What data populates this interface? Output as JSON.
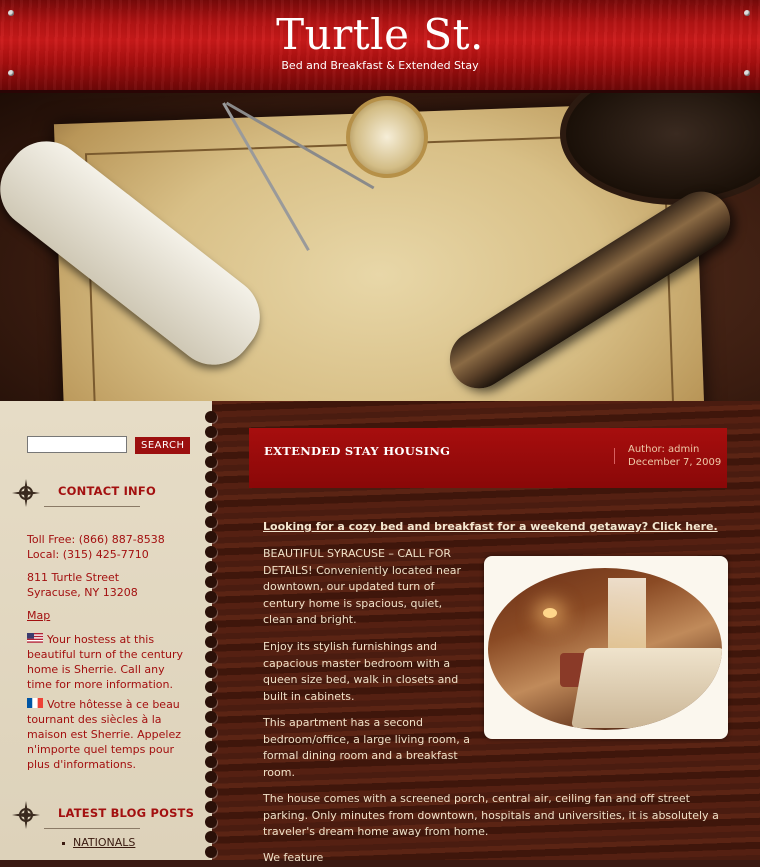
{
  "header": {
    "title": "Turtle St.",
    "tagline": "Bed and Breakfast & Extended Stay"
  },
  "sidebar": {
    "search": {
      "placeholder": "",
      "value": "",
      "button_label": "SEARCH"
    },
    "contact": {
      "heading": "CONTACT INFO",
      "toll_free": "Toll Free: (866) 887-8538",
      "local": "Local: (315) 425-7710",
      "address_line1": "811 Turtle Street",
      "address_line2": "Syracuse, NY 13208",
      "map_link": "Map",
      "english_note": "Your hostess at this beautiful turn of the century home is Sherrie. Call any time for more information.",
      "french_note": "Votre hôtesse à ce beau tournant des siècles à la maison est Sherrie. Appelez n'importe quel temps pour plus d'informations."
    },
    "blog": {
      "heading": "LATEST BLOG POSTS",
      "items": [
        "NATIONALS"
      ]
    }
  },
  "post": {
    "title": "EXTENDED STAY HOUSING",
    "author": "Author: admin",
    "date": "December 7, 2009",
    "intro_link": "Looking for a cozy bed and breakfast for a weekend getaway? Click here.",
    "p1": "BEAUTIFUL SYRACUSE – CALL FOR DETAILS! Conveniently located near downtown, our updated turn of century home is spacious, quiet, clean and bright.",
    "p2": "Enjoy its stylish furnishings and capacious master bedroom with a queen size bed, walk in closets and built in cabinets.",
    "p3": "This apartment has a second bedroom/office, a large living room, a formal dining room and a breakfast room.",
    "p4": "The house comes with a screened porch, central air, ceiling fan and off street parking. Only minutes from downtown, hospitals and universities, it is absolutely a traveler's dream home away from home.",
    "p5": "We feature"
  },
  "colors": {
    "accent": "#a31010",
    "header_red": "#b51414",
    "sidebar_bg": "#e6dcc6",
    "wood": "#4a1c10"
  }
}
